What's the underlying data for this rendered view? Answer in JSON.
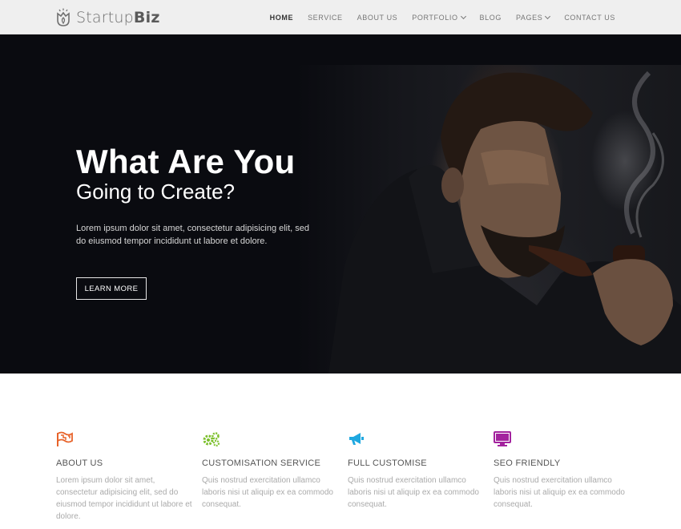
{
  "brand": {
    "name_light": "Startup",
    "name_bold": "Biz"
  },
  "nav": {
    "items": [
      {
        "label": "HOME",
        "active": true,
        "dropdown": false
      },
      {
        "label": "SERVICE",
        "active": false,
        "dropdown": false
      },
      {
        "label": "ABOUT US",
        "active": false,
        "dropdown": false
      },
      {
        "label": "PORTFOLIO",
        "active": false,
        "dropdown": true
      },
      {
        "label": "BLOG",
        "active": false,
        "dropdown": false
      },
      {
        "label": "PAGES",
        "active": false,
        "dropdown": true
      },
      {
        "label": "CONTACT US",
        "active": false,
        "dropdown": false
      }
    ]
  },
  "hero": {
    "title": "What Are You",
    "subtitle": "Going to Create?",
    "text": "Lorem ipsum dolor sit amet, consectetur adipisicing elit, sed do eiusmod tempor incididunt ut labore et dolore.",
    "button_label": "LEARN MORE"
  },
  "features": [
    {
      "icon": "flag-icon",
      "color": "#e8632a",
      "title": "ABOUT US",
      "text": "Lorem ipsum dolor sit amet, consectetur adipisicing elit, sed do eiusmod tempor incididunt ut labore et dolore."
    },
    {
      "icon": "gears-icon",
      "color": "#7bbf2a",
      "title": "CUSTOMISATION SERVICE",
      "text": "Quis nostrud exercitation ullamco laboris nisi ut aliquip ex ea commodo consequat."
    },
    {
      "icon": "megaphone-icon",
      "color": "#1fa8e0",
      "title": "FULL CUSTOMISE",
      "text": "Quis nostrud exercitation ullamco laboris nisi ut aliquip ex ea commodo consequat."
    },
    {
      "icon": "monitor-icon",
      "color": "#a3239e",
      "title": "SEO FRIENDLY",
      "text": "Quis nostrud exercitation ullamco laboris nisi ut aliquip ex ea commodo consequat."
    }
  ]
}
